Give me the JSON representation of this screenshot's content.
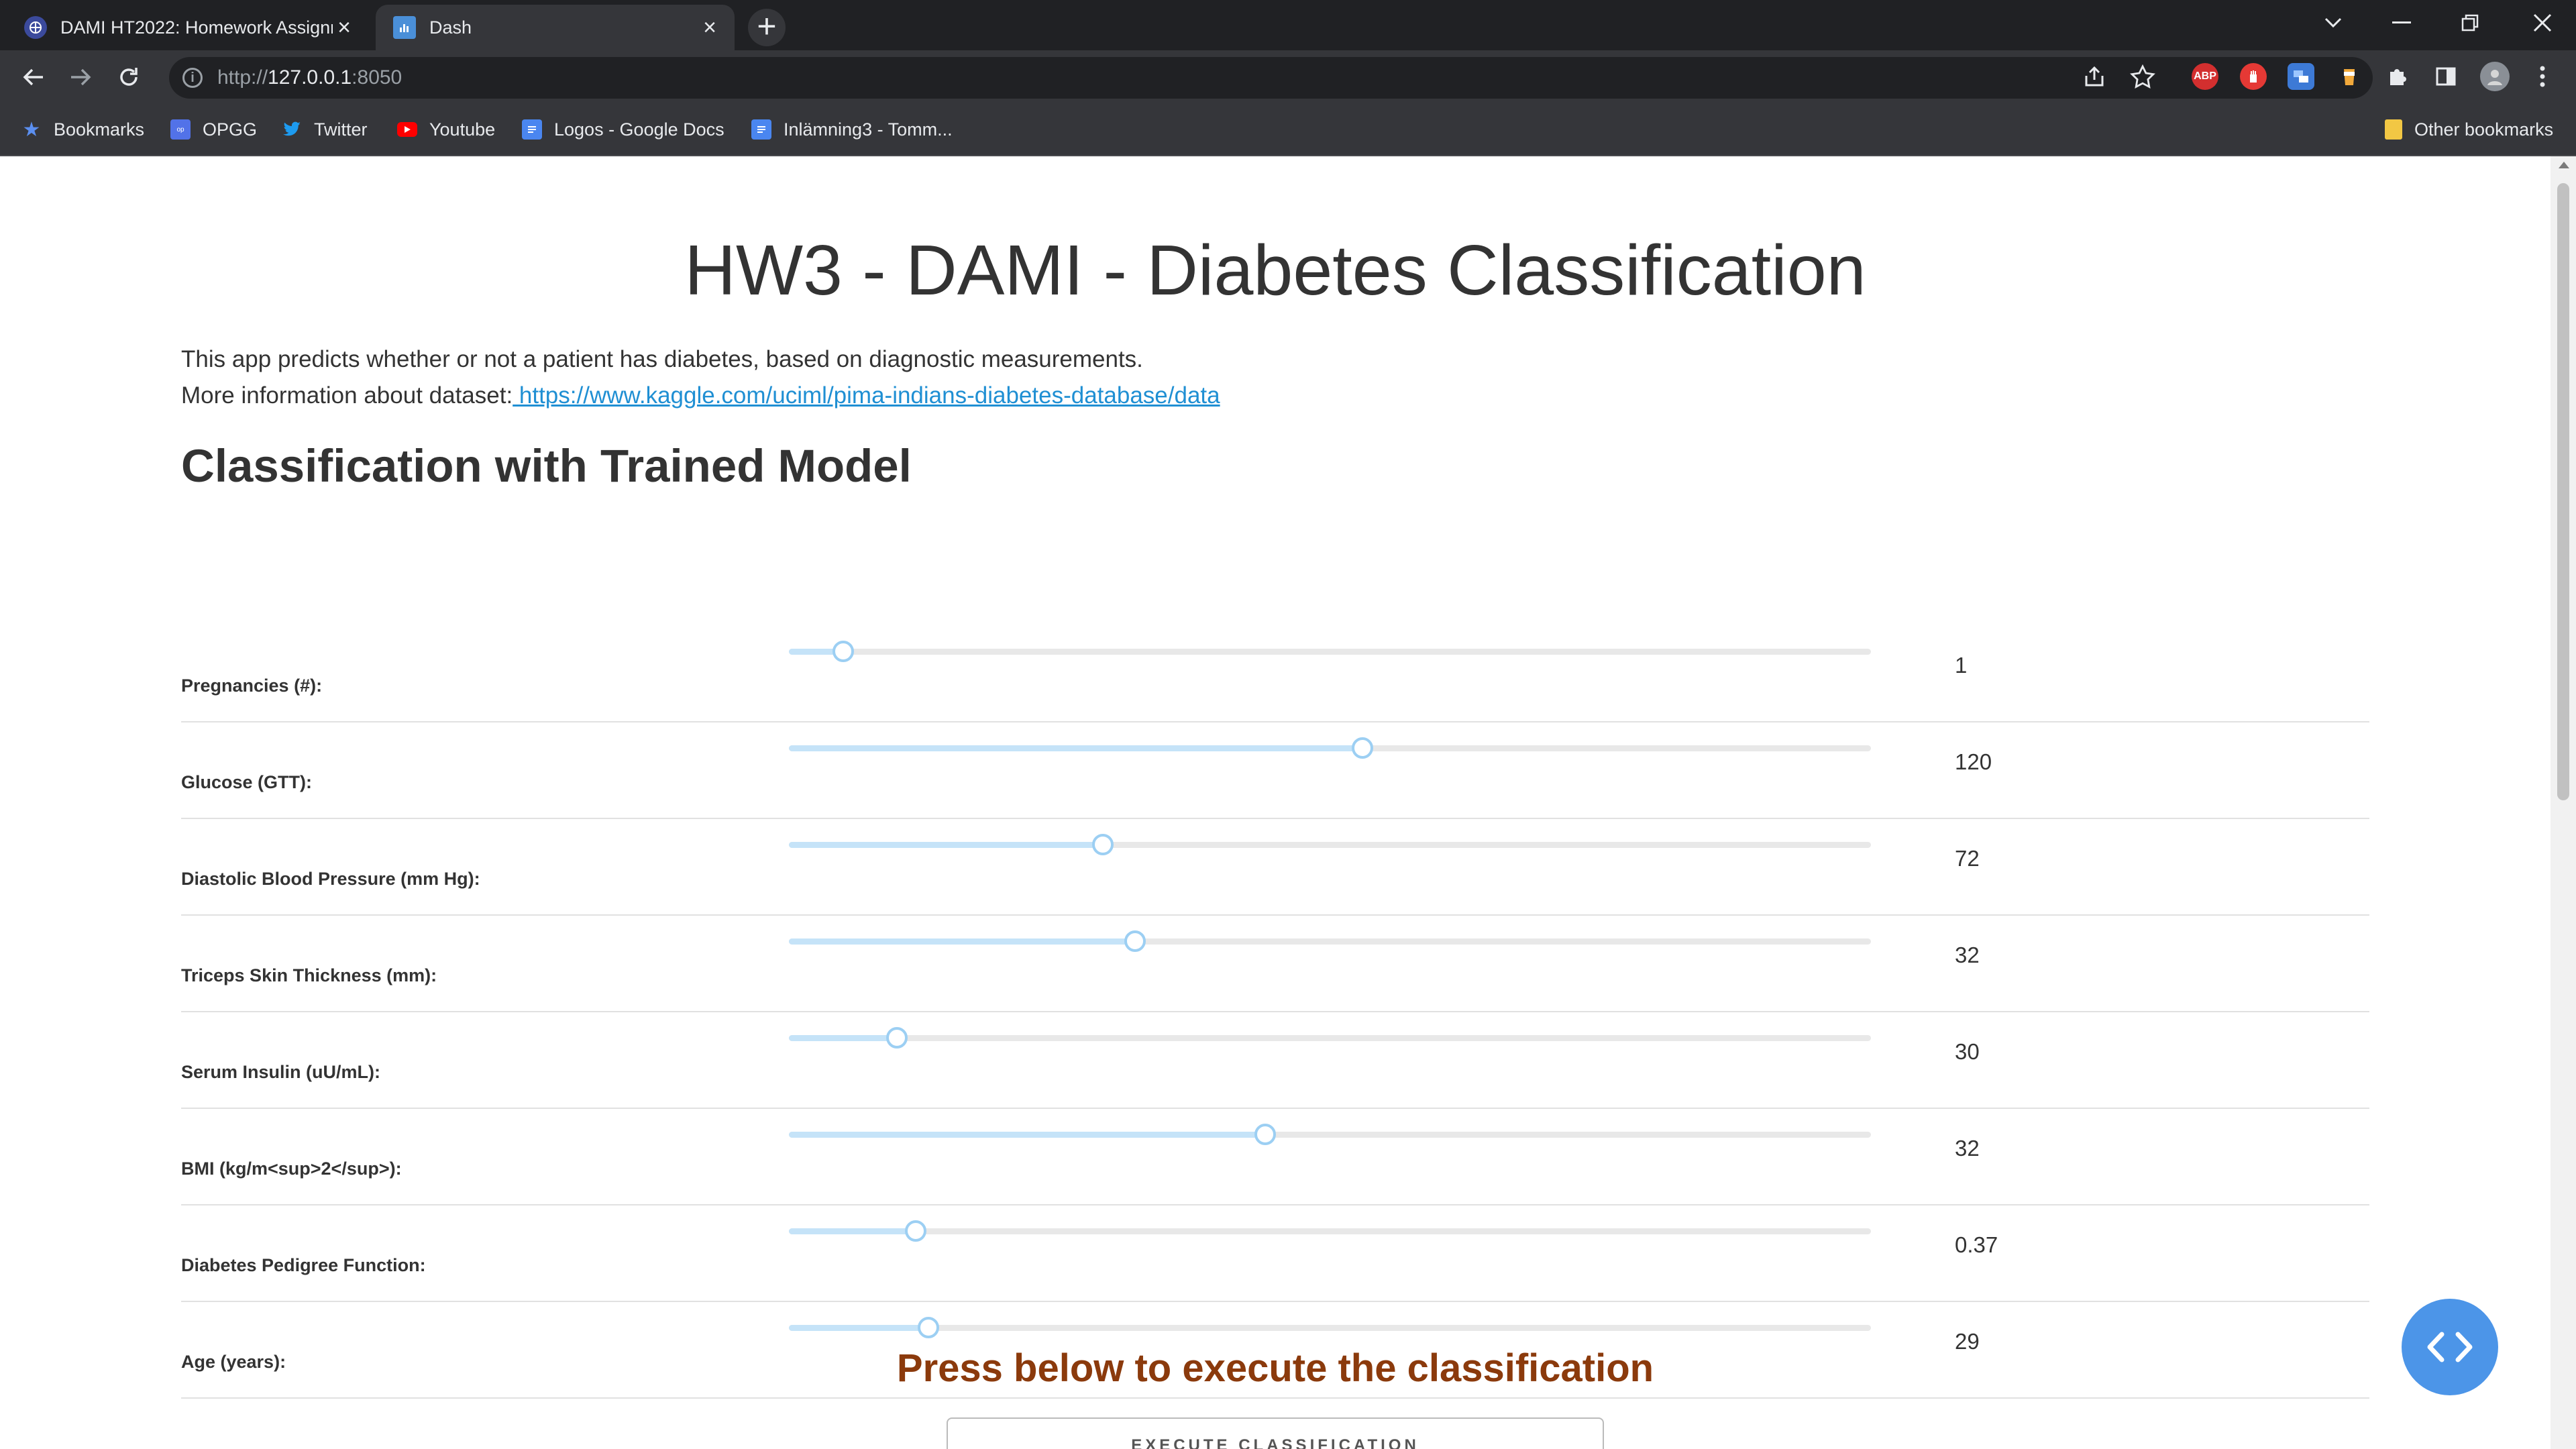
{
  "browser": {
    "tabs": [
      {
        "title": "DAMI HT2022: Homework Assignment",
        "active": false
      },
      {
        "title": "Dash",
        "active": true
      }
    ],
    "url": {
      "scheme": "http://",
      "host": "127.0.0.1",
      "port": ":8050"
    },
    "bookmarks": [
      {
        "label": "Bookmarks"
      },
      {
        "label": "OPGG"
      },
      {
        "label": "Twitter"
      },
      {
        "label": "Youtube"
      },
      {
        "label": "Logos - Google Docs"
      },
      {
        "label": "Inlämning3 - Tomm..."
      }
    ],
    "other_bookmarks": "Other bookmarks",
    "extension_badge": "ABP"
  },
  "page": {
    "title": "HW3 - DAMI - Diabetes Classification",
    "description": "This app predicts whether or not a patient has diabetes, based on diagnostic measurements.",
    "more_info_prefix": "More information about dataset:",
    "more_info_link": " https://www.kaggle.com/uciml/pima-indians-diabetes-database/data",
    "subtitle": "Classification with Trained Model",
    "sliders": [
      {
        "label": "Pregnancies (#):",
        "value": "1",
        "fraction": 0.05
      },
      {
        "label": "Glucose (GTT):",
        "value": "120",
        "fraction": 0.53
      },
      {
        "label": "Diastolic Blood Pressure (mm Hg):",
        "value": "72",
        "fraction": 0.29
      },
      {
        "label": "Triceps Skin Thickness (mm):",
        "value": "32",
        "fraction": 0.32
      },
      {
        "label": "Serum Insulin (uU/mL):",
        "value": "30",
        "fraction": 0.1
      },
      {
        "label": "BMI (kg/m<sup>2</sup>):",
        "value": "32",
        "fraction": 0.44
      },
      {
        "label": "Diabetes Pedigree Function:",
        "value": "0.37",
        "fraction": 0.117
      },
      {
        "label": "Age (years):",
        "value": "29",
        "fraction": 0.129
      }
    ],
    "cta": "Press below to execute the classification",
    "execute_button": "EXECUTE CLASSIFICATION"
  },
  "colors": {
    "accent": "#1f8fd3",
    "cta": "#8b3a0c",
    "slider_handle": "#9ccff3",
    "fab": "#4c95e8"
  }
}
